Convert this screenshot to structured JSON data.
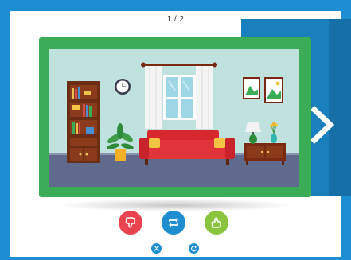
{
  "pagination": {
    "text": "1 / 2"
  },
  "card": {
    "current_index": 1,
    "total": 2
  },
  "colors": {
    "frame": "#1d8ed1",
    "card_border": "#3bad57",
    "dislike": "#e8434e",
    "repeat": "#1f8ed0",
    "like": "#8bc43f"
  },
  "icons": {
    "next": "chevron-right-icon",
    "dislike": "thumbs-down-icon",
    "repeat": "repeat-icon",
    "like": "thumbs-up-icon",
    "shuffle": "shuffle-icon",
    "refresh": "refresh-icon"
  }
}
